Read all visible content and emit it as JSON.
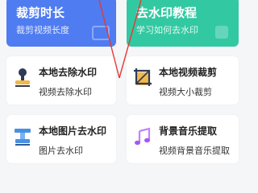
{
  "top_cards": [
    {
      "title": "裁剪时长",
      "subtitle": "裁剪视频长度",
      "color": "#4f7cf1"
    },
    {
      "title": "去水印教程",
      "subtitle": "学习如何去水印",
      "color": "#32c9a2"
    }
  ],
  "features": [
    {
      "title": "本地去除水印",
      "subtitle": "视频去除水印",
      "icon": "stamp-icon"
    },
    {
      "title": "本地视频裁剪",
      "subtitle": "视频大小裁剪",
      "icon": "crop-icon"
    },
    {
      "title": "本地图片去水印",
      "subtitle": "图片去水印",
      "icon": "image-stamp-icon"
    },
    {
      "title": "背景音乐提取",
      "subtitle": "视频背景音乐提取",
      "icon": "music-note-icon"
    }
  ],
  "annotation_color": "#e53935"
}
